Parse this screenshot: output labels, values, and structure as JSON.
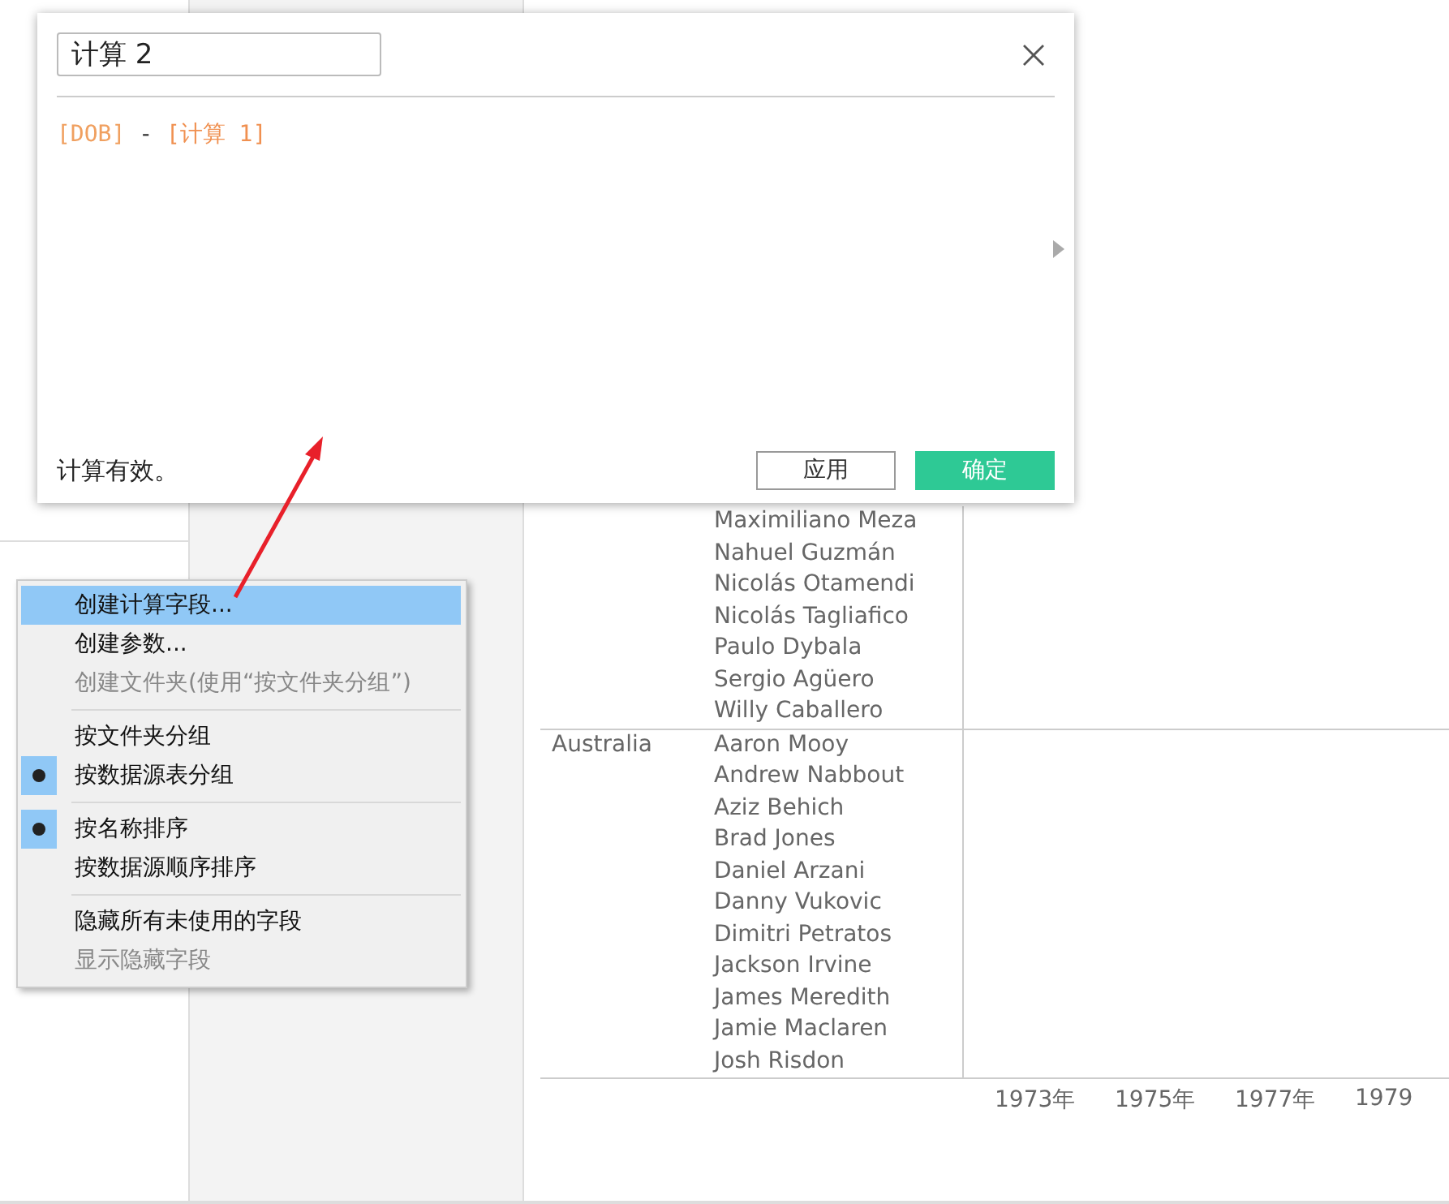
{
  "dialog": {
    "name_field": {
      "value": "计算 2"
    },
    "formula": [
      {
        "text": "[DOB]",
        "kind": "field"
      },
      {
        "text": " - ",
        "kind": "operator"
      },
      {
        "text": "[计算 1]",
        "kind": "calc"
      }
    ],
    "status": "计算有效。",
    "buttons": [
      {
        "label": "应用",
        "kind": "secondary"
      },
      {
        "label": "确定",
        "kind": "primary"
      }
    ]
  },
  "context_menu": {
    "items": [
      {
        "kind": "item",
        "label": "创建计算字段...",
        "selected": true,
        "disabled": false,
        "checked": false
      },
      {
        "kind": "item",
        "label": "创建参数...",
        "selected": false,
        "disabled": false,
        "checked": false
      },
      {
        "kind": "item",
        "label": "创建文件夹(使用“按文件夹分组”)",
        "selected": false,
        "disabled": true,
        "checked": false
      },
      {
        "kind": "separator"
      },
      {
        "kind": "item",
        "label": "按文件夹分组",
        "selected": false,
        "disabled": false,
        "checked": false
      },
      {
        "kind": "item",
        "label": "按数据源表分组",
        "selected": false,
        "disabled": false,
        "checked": true
      },
      {
        "kind": "separator"
      },
      {
        "kind": "item",
        "label": "按名称排序",
        "selected": false,
        "disabled": false,
        "checked": true
      },
      {
        "kind": "item",
        "label": "按数据源顺序排序",
        "selected": false,
        "disabled": false,
        "checked": false
      },
      {
        "kind": "separator"
      },
      {
        "kind": "item",
        "label": "隐藏所有未使用的字段",
        "selected": false,
        "disabled": false,
        "checked": false
      },
      {
        "kind": "item",
        "label": "显示隐藏字段",
        "selected": false,
        "disabled": true,
        "checked": false
      }
    ]
  },
  "table": {
    "groups": [
      {
        "players": [
          "Maximiliano Meza",
          "Nahuel Guzmán",
          "Nicolás Otamendi",
          "Nicolás Tagliafico",
          "Paulo Dybala",
          "Sergio Agüero",
          "Willy Caballero"
        ]
      },
      {
        "country": "Australia",
        "players": [
          "Aaron Mooy",
          "Andrew Nabbout",
          "Aziz Behich",
          "Brad Jones",
          "Daniel Arzani",
          "Danny Vukovic",
          "Dimitri Petratos",
          "Jackson Irvine",
          "James Meredith",
          "Jamie Maclaren",
          "Josh Risdon"
        ]
      }
    ],
    "axis_labels": [
      "1973年",
      "1975年",
      "1977年",
      "1979"
    ]
  }
}
